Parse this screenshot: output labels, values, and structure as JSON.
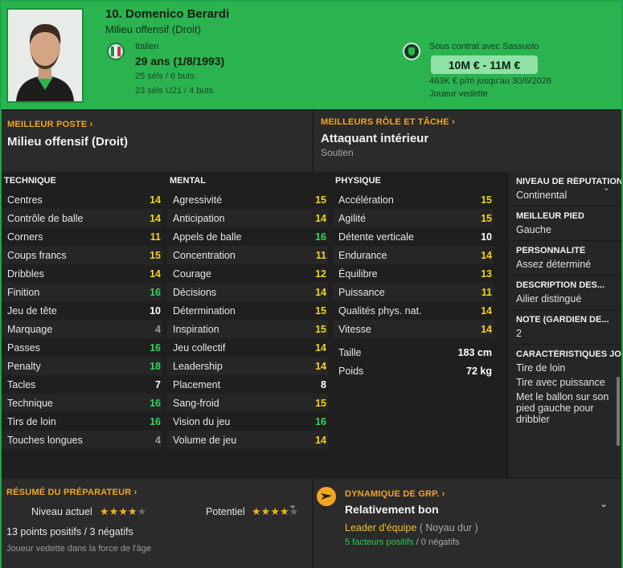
{
  "header": {
    "name": "10. Domenico Berardi",
    "position": "Milieu offensif (Droit)",
    "nationality": "Italien",
    "age": "29 ans (1/8/1993)",
    "caps": "25 séls / 6 buts",
    "caps_u21": "23 séls U21 / 4 buts",
    "contract": "Sous contrat avec Sassuolo",
    "value": "10M € - 11M €",
    "wage": "463K € p/m jusqu'au 30/6/2026",
    "status": "Joueur vedette"
  },
  "best_position": {
    "title": "MEILLEUR POSTE",
    "value": "Milieu offensif (Droit)"
  },
  "best_role": {
    "title": "MEILLEURS RÔLE ET TÂCHE",
    "value": "Attaquant intérieur",
    "duty": "Soutien"
  },
  "technique": {
    "title": "TECHNIQUE",
    "rows": [
      {
        "label": "Centres",
        "value": "14"
      },
      {
        "label": "Contrôle de balle",
        "value": "14"
      },
      {
        "label": "Corners",
        "value": "11"
      },
      {
        "label": "Coups francs",
        "value": "15"
      },
      {
        "label": "Dribbles",
        "value": "14"
      },
      {
        "label": "Finition",
        "value": "16"
      },
      {
        "label": "Jeu de tête",
        "value": "10"
      },
      {
        "label": "Marquage",
        "value": "4"
      },
      {
        "label": "Passes",
        "value": "16"
      },
      {
        "label": "Penalty",
        "value": "18"
      },
      {
        "label": "Tacles",
        "value": "7"
      },
      {
        "label": "Technique",
        "value": "16"
      },
      {
        "label": "Tirs de loin",
        "value": "16"
      },
      {
        "label": "Touches longues",
        "value": "4"
      }
    ]
  },
  "mental": {
    "title": "MENTAL",
    "rows": [
      {
        "label": "Agressivité",
        "value": "15"
      },
      {
        "label": "Anticipation",
        "value": "14"
      },
      {
        "label": "Appels de balle",
        "value": "16"
      },
      {
        "label": "Concentration",
        "value": "11"
      },
      {
        "label": "Courage",
        "value": "12"
      },
      {
        "label": "Décisions",
        "value": "14"
      },
      {
        "label": "Détermination",
        "value": "15"
      },
      {
        "label": "Inspiration",
        "value": "15"
      },
      {
        "label": "Jeu collectif",
        "value": "14"
      },
      {
        "label": "Leadership",
        "value": "14"
      },
      {
        "label": "Placement",
        "value": "8"
      },
      {
        "label": "Sang-froid",
        "value": "15"
      },
      {
        "label": "Vision du jeu",
        "value": "16"
      },
      {
        "label": "Volume de jeu",
        "value": "14"
      }
    ]
  },
  "physique": {
    "title": "PHYSIQUE",
    "rows": [
      {
        "label": "Accélération",
        "value": "15"
      },
      {
        "label": "Agilité",
        "value": "15"
      },
      {
        "label": "Détente verticale",
        "value": "10"
      },
      {
        "label": "Endurance",
        "value": "14"
      },
      {
        "label": "Équilibre",
        "value": "13"
      },
      {
        "label": "Puissance",
        "value": "11"
      },
      {
        "label": "Qualités phys. nat.",
        "value": "14"
      },
      {
        "label": "Vitesse",
        "value": "14"
      }
    ],
    "height_label": "Taille",
    "height": "183 cm",
    "weight_label": "Poids",
    "weight": "72 kg"
  },
  "side": {
    "reputation_title": "NIVEAU DE RÉPUTATION",
    "reputation": "Continental",
    "foot_title": "MEILLEUR PIED",
    "foot": "Gauche",
    "personality_title": "PERSONNALITÉ",
    "personality": "Assez déterminé",
    "description_title": "DESCRIPTION DES...",
    "description": "Ailier distingué",
    "gk_title": "NOTE (GARDIEN DE...",
    "gk": "2",
    "traits_title": "CARACTÉRISTIQUES JOUEUR",
    "traits": [
      "Tire de loin",
      "Tire avec puissance",
      "Met le ballon sur son pied gauche pour dribbler"
    ]
  },
  "coach": {
    "title": "RÉSUMÉ DU PRÉPARATEUR",
    "current_label": "Niveau actuel",
    "current_stars": 4,
    "potential_label": "Potentiel",
    "potential_stars": 4,
    "points": "13 points positifs / 3 négatifs",
    "desc": "Joueur vedette dans la force de l'âge"
  },
  "dynamics": {
    "title": "DYNAMIQUE DE GRP.",
    "value": "Relativement bon",
    "leader": "Leader d'équipe",
    "leader_sub": "( Noyau dur )",
    "positive": "5 facteurs positifs",
    "sep": "/",
    "negative": "0 négatifs"
  },
  "colors": {
    "header_green": "#2bb350",
    "accent_orange": "#f0a524",
    "stat_yellow": "#f2d21e",
    "stat_green": "#32d65a",
    "stat_grey": "#9a9a9a"
  }
}
